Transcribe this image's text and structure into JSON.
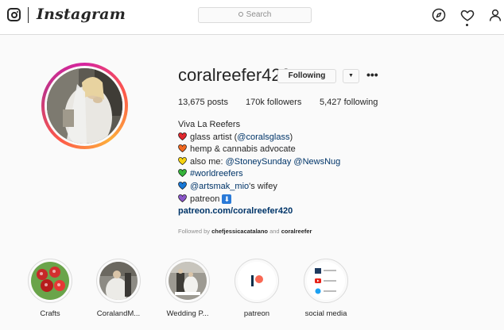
{
  "app": {
    "wordmark": "Instagram"
  },
  "search": {
    "placeholder": "Search"
  },
  "nav": {
    "icons": [
      "explore-compass-icon",
      "activity-heart-icon",
      "profile-person-icon"
    ]
  },
  "profile": {
    "username": "coralreefer420",
    "following_label": "Following",
    "dropdown_glyph": "▼",
    "more_glyph": "•••",
    "stats": {
      "posts": "13,675 posts",
      "followers": "170k followers",
      "following": "5,427 following"
    },
    "bio": {
      "name": "Viva La Reefers",
      "lines": [
        {
          "heart_color": "#e0272e",
          "pre": "glass artist (",
          "mention": "@coralsglass",
          "post": ")"
        },
        {
          "heart_color": "#f06820",
          "pre": "hemp & cannabis advocate",
          "mention": "",
          "post": ""
        },
        {
          "heart_color": "#f5d210",
          "pre": "also me: ",
          "mention": "@StoneySunday @NewsNug",
          "post": ""
        },
        {
          "heart_color": "#35b33a",
          "pre": "",
          "mention": "#worldreefers",
          "post": ""
        },
        {
          "heart_color": "#1877d6",
          "pre": "",
          "mention": "@artsmak_mio",
          "post": "'s wifey"
        },
        {
          "heart_color": "#8a56c8",
          "pre": "patreon ",
          "mention": "",
          "post": "⬇"
        }
      ],
      "external_link": "patreon.com/coralreefer420"
    },
    "followed_by": {
      "prefix": "Followed by",
      "user1": "chefjessicacatalano",
      "conj": "and",
      "user2": "coralreefer"
    }
  },
  "highlights": [
    {
      "label": "Crafts"
    },
    {
      "label": "CoralandM..."
    },
    {
      "label": "Wedding P..."
    },
    {
      "label": "patreon"
    },
    {
      "label": "social media"
    }
  ],
  "colors": {
    "story_gradient": [
      "#d6249f",
      "#fd5949",
      "#fdae3b"
    ],
    "link": "#003569",
    "patreon": "#f96854"
  }
}
